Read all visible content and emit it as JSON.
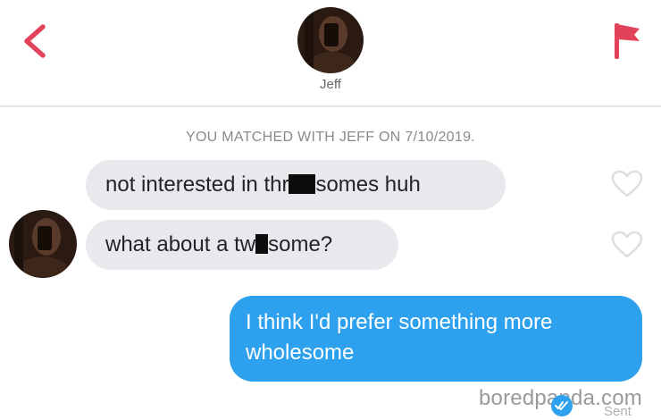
{
  "header": {
    "contact_name": "Jeff",
    "back_icon": "chevron-left-icon",
    "report_icon": "flag-icon"
  },
  "match_notice": "YOU MATCHED WITH JEFF ON 7/10/2019.",
  "messages": [
    {
      "direction": "received",
      "parts": [
        "not interested in thr",
        "somes huh"
      ],
      "redacted_between_parts": true,
      "like_icon": "heart-outline-icon"
    },
    {
      "direction": "received",
      "parts": [
        "what about a tw",
        "some?"
      ],
      "redacted_between_parts": true,
      "like_icon": "heart-outline-icon"
    },
    {
      "direction": "sent",
      "text": "I think I'd prefer something more wholesome",
      "status": "Sent",
      "status_icon": "double-check-icon"
    }
  ],
  "watermark": "boredpanda.com",
  "colors": {
    "accent_red": "#e3435a",
    "sent_bubble": "#2ea1ee",
    "received_bubble": "#e8e9ec"
  }
}
